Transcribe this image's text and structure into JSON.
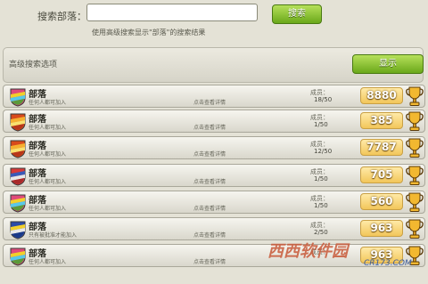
{
  "search": {
    "label": "搜索部落：",
    "value": "",
    "button": "搜索",
    "hint": "使用高级搜索显示\"部落\"的搜索结果"
  },
  "advanced": {
    "label": "高级搜索选项",
    "button": "显示"
  },
  "clan_rows": [
    {
      "name": "部落",
      "access": "任何人都可加入",
      "detail": "点击查看详情",
      "members_label": "成员：",
      "members": "18/50",
      "score": "8880",
      "badge_colors": [
        "#e04a7a",
        "#f2d02a",
        "#58c8e8",
        "#5a9a3a"
      ]
    },
    {
      "name": "部落",
      "access": "任何人都可加入",
      "detail": "点击查看详情",
      "members_label": "成员：",
      "members": "1/50",
      "score": "385",
      "badge_colors": [
        "#d84a1a",
        "#f5b030",
        "#f8e070",
        "#b8361a"
      ]
    },
    {
      "name": "部落",
      "access": "任何人都可加入",
      "detail": "点击查看详情",
      "members_label": "成员：",
      "members": "12/50",
      "score": "7787",
      "badge_colors": [
        "#d84a1a",
        "#f5b030",
        "#f8e070",
        "#b8361a"
      ]
    },
    {
      "name": "部落",
      "access": "任何人都可加入",
      "detail": "点击查看详情",
      "members_label": "成员：",
      "members": "1/50",
      "score": "705",
      "badge_colors": [
        "#d83a3a",
        "#3a5ab8",
        "#e8e8e8",
        "#a82a2a"
      ]
    },
    {
      "name": "部落",
      "access": "任何人都可加入",
      "detail": "点击查看详情",
      "members_label": "成员：",
      "members": "1/50",
      "score": "560",
      "badge_colors": [
        "#e04a7a",
        "#f2d02a",
        "#58c8e8",
        "#5a9a3a"
      ]
    },
    {
      "name": "部落",
      "access": "只有被批准才能加入",
      "detail": "点击查看详情",
      "members_label": "成员：",
      "members": "2/50",
      "score": "963",
      "badge_colors": [
        "#2a4aa8",
        "#f2d02a",
        "#e8e8e8",
        "#1a3a88"
      ]
    },
    {
      "name": "部落",
      "access": "任何人都可加入",
      "detail": "点击查看详情",
      "members_label": "成员：",
      "members": "",
      "score": "963",
      "badge_colors": [
        "#e04a7a",
        "#f2d02a",
        "#58c8e8",
        "#5a9a3a"
      ]
    }
  ],
  "watermark": {
    "text": "西西软件园",
    "sub": "CR173.COM"
  },
  "colors": {
    "accent_green": "#6aa81a",
    "score_gold": "#f2c65a",
    "row_bg": "#e9e7de"
  }
}
